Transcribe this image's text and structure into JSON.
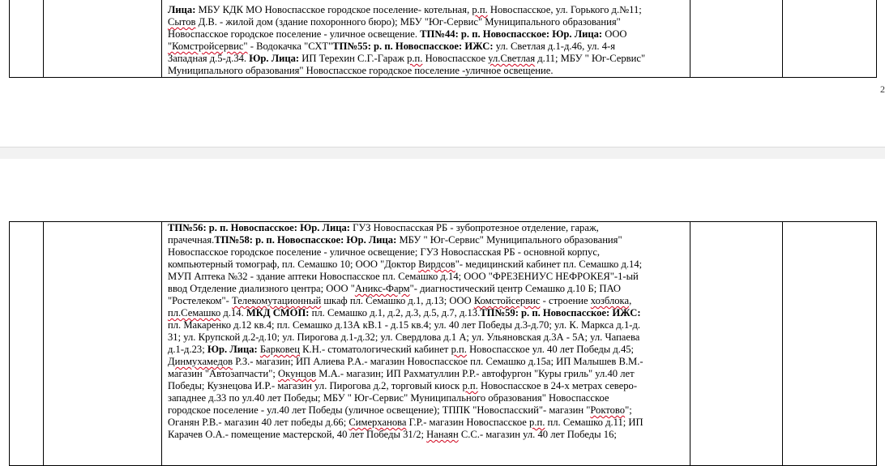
{
  "page_number": "2",
  "top_block": [
    [
      {
        "t": "Лица:",
        "b": true
      },
      {
        "t": " МБУ КДК МО Новоспасское городское поселение- котельная, "
      },
      {
        "t": "р.п.",
        "s": 1
      },
      {
        "t": " Новоспасское, ул. Горького д.№11;"
      }
    ],
    [
      {
        "t": "Сытов",
        "s": 1
      },
      {
        "t": " Д.В. - жилой дом (здание похоронного бюро); МБУ \"Юг-Сервис\" Муниципального образования\""
      }
    ],
    [
      {
        "t": "Новоспасское городское поселение - уличное освещение. "
      },
      {
        "t": "ТП№44:  р. п. Новоспасское: Юр. Лица:",
        "b": true
      },
      {
        "t": " ООО"
      }
    ],
    [
      {
        "t": "\"Комстройсервис\"",
        "s": 1
      },
      {
        "t": " - Водокачка \"СХТ\""
      },
      {
        "t": "ТП№55:  р. п. Новоспасское: ИЖС:",
        "b": true
      },
      {
        "t": " ул. Светлая д.1-д.46, ул. 4-я"
      }
    ],
    [
      {
        "t": "Западная д.5-д.34. "
      },
      {
        "t": "Юр. Лица:",
        "b": true
      },
      {
        "t": " ИП Терехин С.Г.-Гараж "
      },
      {
        "t": "р.п.",
        "s": 1
      },
      {
        "t": " Новоспасское "
      },
      {
        "t": "ул.Светлая",
        "s": 1
      },
      {
        "t": " д.11; МБУ \" Юг-Сервис\""
      }
    ],
    [
      {
        "t": "Муниципального образования\" Новоспасское городское поселение -уличное освещение."
      }
    ]
  ],
  "bottom_block": [
    [
      {
        "t": "ТП№56: р. п. Новоспасское: Юр. Лица:",
        "b": true
      },
      {
        "t": " ГУЗ Новоспасская РБ - зубопротезное отделение, гараж,"
      }
    ],
    [
      {
        "t": "прачечная."
      },
      {
        "t": "ТП№58: р. п. Новоспасское: Юр. Лица:",
        "b": true
      },
      {
        "t": "  МБУ \" Юг-Сервис\" Муниципального образования\""
      }
    ],
    [
      {
        "t": "Новоспасское городское поселение -  уличное освещение; ГУЗ Новоспасская РБ -  основной корпус,"
      }
    ],
    [
      {
        "t": "компьютерный томограф, пл. Семашко 10; ООО \"Доктор "
      },
      {
        "t": "Вирдсов",
        "s": 1
      },
      {
        "t": "\"- медицинский кабинет пл. Семашко д.14;"
      }
    ],
    [
      {
        "t": "МУП Аптека №32 - здание аптеки Новоспасское пл. Семашко д.14; ООО \"ФРЕЗЕНИУС НЕФРОКЕЯ\"-1-ый"
      }
    ],
    [
      {
        "t": "ввод Отделение диализного центра; ООО \""
      },
      {
        "t": "Аникс-Фарм",
        "s": 1
      },
      {
        "t": "\"- диагностический центр Семашко д.10 Б; ПАО"
      }
    ],
    [
      {
        "t": "\"Ростелеком\"- "
      },
      {
        "t": "Телекомутационный",
        "s": 1
      },
      {
        "t": " шкаф пл. Семашко д.1, д.13; ООО "
      },
      {
        "t": "Комстойсервис",
        "s": 1
      },
      {
        "t": " -  строение "
      },
      {
        "t": "хозблока",
        "s": 1
      },
      {
        "t": ","
      }
    ],
    [
      {
        "t": "пл.Семашко",
        "s": 1
      },
      {
        "t": " д.14. "
      },
      {
        "t": "МКД СМОП:",
        "b": true
      },
      {
        "t": " пл. Семашко д.1, д.2, д.3, д.5, д.7, д.13."
      },
      {
        "t": "ТП№59:  р. п. Новоспасское: ИЖС:",
        "b": true
      }
    ],
    [
      {
        "t": "пл. Макаренко д.12 кв.4; пл. Семашко д.13А кВ.1 - д.15 кв.4; ул. 40 лет Победы д.3-д.70; ул. К. Маркса д.1-д."
      }
    ],
    [
      {
        "t": "31; ул. Крупской д.2-д.10; ул. Пирогова д.1-д.32; ул. Свердлова д.1 А;  ул. Ульяновская д.3А - 5А; ул. Чапаева"
      }
    ],
    [
      {
        "t": "д.1-д.23; "
      },
      {
        "t": "Юр. Лица:",
        "b": true
      },
      {
        "t": " "
      },
      {
        "t": "Барковец",
        "s": 1
      },
      {
        "t": " К.Н.-  стоматологический кабинет "
      },
      {
        "t": "р.п.",
        "s": 1
      },
      {
        "t": " Новоспасское ул. 40 лет Победы д.45;"
      }
    ],
    [
      {
        "t": "Динмухамедов",
        "s": 1
      },
      {
        "t": " Р.З.- магазин; ИП Алиева Р.А.-  магазин  Новоспасское пл. Семашко д.15а; ИП Малышев В.М.-"
      }
    ],
    [
      {
        "t": "магазин  \"Автозапчасти\"; "
      },
      {
        "t": "Окунцов",
        "s": 1
      },
      {
        "t": " М.А.- магазин; ИП Рахматуллин Р.Р.- автофургон \"Куры гриль\" ул.40 лет"
      }
    ],
    [
      {
        "t": "Победы; Кузнецова И.Р.- магазин ул. Пирогова д.2, торговый киоск "
      },
      {
        "t": "р.п.",
        "s": 1
      },
      {
        "t": " Новоспасское  в 24-х метрах северо-"
      }
    ],
    [
      {
        "t": "западнее д.33 по ул.40 лет Победы; МБУ \" Юг-Сервис\" Муниципального образования\" Новоспасское"
      }
    ],
    [
      {
        "t": "городское поселение - ул.40 лет Победы (уличное освещение); ТППК \"Новоспасский\"- магазин \""
      },
      {
        "t": "Роктово",
        "s": 1
      },
      {
        "t": "\";"
      }
    ],
    [
      {
        "t": "Оганян Р.В.- магазин 40 лет победы д.66; "
      },
      {
        "t": "Симерханова",
        "s": 1
      },
      {
        "t": " Г.Р.-  магазин Новоспасское "
      },
      {
        "t": "р.п.",
        "s": 1
      },
      {
        "t": " пл. Семашко д.11; ИП"
      }
    ],
    [
      {
        "t": "Карачев О.А.-  помещение мастерской, 40 лет Победы 31/2; "
      },
      {
        "t": "Нанаян",
        "s": 1
      },
      {
        "t": " С.С.- магазин ул. 40 лет Победы 16;"
      }
    ]
  ]
}
